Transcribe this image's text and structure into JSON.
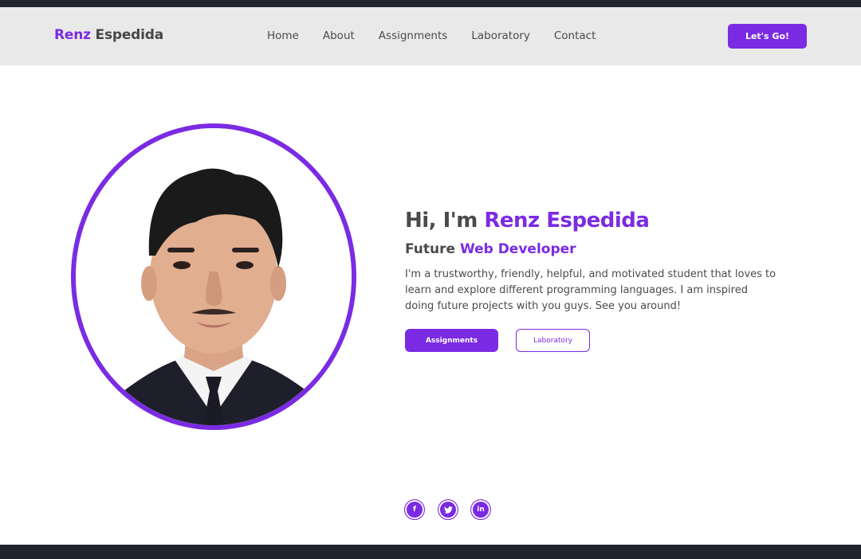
{
  "brand": {
    "first": "Renz",
    "last": "Espedida"
  },
  "nav": {
    "links": [
      "Home",
      "About",
      "Assignments",
      "Laboratory",
      "Contact"
    ],
    "cta_label": "Let's Go!"
  },
  "hero": {
    "greeting": "Hi, I'm ",
    "name": "Renz Espedida",
    "subtitle_prefix": "Future ",
    "subtitle_role": "Web Developer",
    "description": "I'm a trustworthy, friendly, helpful, and motivated student that loves to learn and explore different programming languages. I am inspired doing future projects with you guys. See you around!",
    "primary_button": "Assignments",
    "secondary_button": "Laboratory"
  },
  "social": {
    "facebook": "f",
    "twitter": "twitter-icon",
    "linkedin": "in"
  },
  "colors": {
    "accent": "#7a2be3",
    "dark": "#22232b",
    "nav_bg": "#e9e9e9"
  }
}
